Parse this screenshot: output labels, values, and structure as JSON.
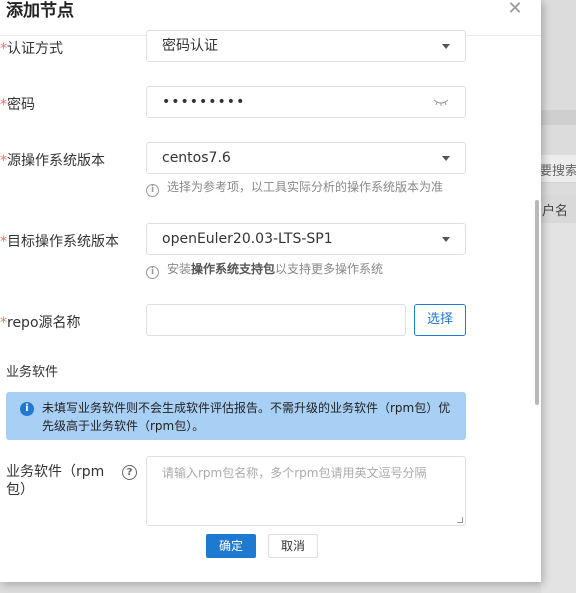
{
  "dialog": {
    "title": "添加节点",
    "close_icon": "close-icon"
  },
  "form": {
    "auth_method": {
      "required_mark": "*",
      "label": "认证方式",
      "value": "密码认证"
    },
    "password": {
      "required_mark": "*",
      "label": "密码",
      "value": "•••••••••",
      "toggle_icon": "eye-closed-icon"
    },
    "source_os": {
      "required_mark": "*",
      "label": "源操作系统版本",
      "value": "centos7.6",
      "hint": "选择为参考项，以工具实际分析的操作系统版本为准"
    },
    "target_os": {
      "required_mark": "*",
      "label": "目标操作系统版本",
      "value": "openEuler20.03-LTS-SP1",
      "hint_prefix": "安装",
      "hint_bold": "操作系统支持包",
      "hint_suffix": "以支持更多操作系统"
    },
    "repo": {
      "required_mark": "*",
      "label": "repo源名称",
      "value": "",
      "choose_label": "选择"
    },
    "business_software": {
      "section_title": "业务软件",
      "notice": "未填写业务软件则不会生成软件评估报告。不需升级的业务软件（rpm包）优先级高于业务软件（rpm包）。",
      "rpm_label": "业务软件（rpm包）",
      "rpm_placeholder": "请输入rpm包名称，多个rpm包请用英文逗号分隔"
    }
  },
  "footer": {
    "ok_label": "确定",
    "cancel_label": "取消"
  },
  "background_page": {
    "text_1": "要搜索",
    "text_2": "户名"
  },
  "colors": {
    "primary": "#1e7ad1",
    "required": "#f56c6c",
    "notice_bg": "#a8cff4"
  }
}
